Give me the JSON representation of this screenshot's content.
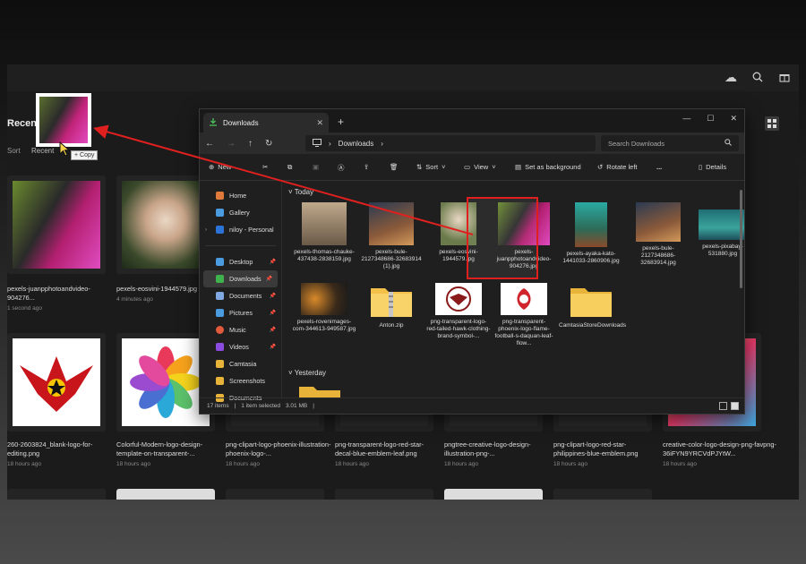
{
  "gallery": {
    "recent_title": "Recent",
    "sort_label": "Sort",
    "recent_filter": "Recent",
    "items": [
      {
        "name": "pexels-juanpphotoandvideo-904276...",
        "time": "1 second ago"
      },
      {
        "name": "pexels-eosvini-1944579.jpg",
        "time": "4 minutes ago"
      },
      {
        "name": "260-2603824_blank-logo-for-editing.png",
        "time": "18 hours ago"
      },
      {
        "name": "Colorful-Modern-logo-design-template-on-transparent-...",
        "time": "18 hours ago"
      },
      {
        "name": "png-clipart-logo-phoenix-illustration-phoenix-logo-...",
        "time": "18 hours ago"
      },
      {
        "name": "png-transparent-logo-red-star-decal-blue-emblem-leaf.png",
        "time": "18 hours ago"
      },
      {
        "name": "pngtree-creative-logo-design-illustration-png-...",
        "time": "18 hours ago"
      },
      {
        "name": "png-clipart-logo-red-star-philippines-blue-emblem.png",
        "time": "18 hours ago"
      },
      {
        "name": "creative-color-logo-design-png-favpng-36iFYN9YRCVdPJYtW...",
        "time": "18 hours ago"
      }
    ]
  },
  "drag": {
    "copy_label": "+ Copy"
  },
  "explorer": {
    "tab_title": "Downloads",
    "breadcrumb": "Downloads",
    "search_placeholder": "Search Downloads",
    "commands": {
      "new": "New",
      "sort": "Sort",
      "view": "View",
      "set_background": "Set as background",
      "rotate_left": "Rotate left",
      "more": "...",
      "details": "Details"
    },
    "nav": [
      {
        "label": "Home",
        "color": "#e07a3b",
        "pinned": false
      },
      {
        "label": "Gallery",
        "color": "#4b9be0",
        "pinned": false
      },
      {
        "label": "niloy - Personal",
        "color": "#2b73d6",
        "pinned": false
      },
      {
        "label": "Desktop",
        "color": "#4b9be0",
        "pinned": true
      },
      {
        "label": "Downloads",
        "color": "#3fb24d",
        "pinned": true
      },
      {
        "label": "Documents",
        "color": "#7fa9e0",
        "pinned": true
      },
      {
        "label": "Pictures",
        "color": "#4b9be0",
        "pinned": true
      },
      {
        "label": "Music",
        "color": "#e05a3b",
        "pinned": true
      },
      {
        "label": "Videos",
        "color": "#8b4be0",
        "pinned": true
      },
      {
        "label": "Camtasia",
        "color": "#e8b339",
        "pinned": false
      },
      {
        "label": "Screenshots",
        "color": "#e8b339",
        "pinned": false
      },
      {
        "label": "Documents",
        "color": "#e8b339",
        "pinned": false
      }
    ],
    "today_label": "Today",
    "yesterday_label": "Yesterday",
    "files": [
      {
        "name": "pexels-thomas-chauke-437438-2838159.jpg"
      },
      {
        "name": "pexels-bule-2127348686-32683914 (1).jpg"
      },
      {
        "name": "pexels-eosvini-1944579.jpg"
      },
      {
        "name": "pexels-juanpphotoandvideo-904276.jpg"
      },
      {
        "name": "pexels-ayaka-kato-1441033-2860906.jpg"
      },
      {
        "name": "pexels-bule-2127348686-32683914.jpg"
      },
      {
        "name": "pexels-pixabay-531880.jpg"
      },
      {
        "name": "pexels-rovenimages-com-344613-949587.jpg"
      },
      {
        "name": "Anton.zip"
      },
      {
        "name": "png-transparent-logo-red-tailed-hawk-clothing-brand-symbol-..."
      },
      {
        "name": "png-transparent-phoenix-logo-flame-football-s-daquan-leaf-flow..."
      },
      {
        "name": "CamtasiaStoreDownloads"
      }
    ],
    "status": {
      "items": "17 items",
      "selected": "1 item selected",
      "size": "3.01 MB"
    }
  }
}
